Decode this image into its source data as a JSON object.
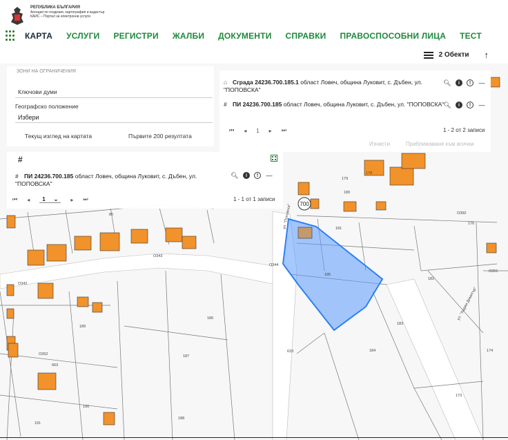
{
  "header": {
    "logo": {
      "line1": "РЕПУБЛИКА БЪЛГАРИЯ",
      "line2": "Агенция по геодезия, картография и кадастър",
      "line3": "КАИС – Портал за електронни услуги"
    },
    "nav": [
      {
        "label": "КАРТА",
        "active": true
      },
      {
        "label": "УСЛУГИ"
      },
      {
        "label": "РЕГИСТРИ"
      },
      {
        "label": "ЖАЛБИ"
      },
      {
        "label": "ДОКУМЕНТИ"
      },
      {
        "label": "СПРАВКИ"
      },
      {
        "label": "ПРАВОСПОСОБНИ ЛИЦА"
      },
      {
        "label": "ТЕСТ"
      }
    ],
    "objects_label": "2 Обекти",
    "up_arrow": "↑"
  },
  "search_panel": {
    "section": "ЗОНИ НА ОГРАНИЧЕНИЯ",
    "keywords_label": "Ключови думи",
    "geo_label": "Географско положение",
    "geo_value": "Избери",
    "option_current": "Текущ изглед на картата",
    "option_first": "Първите 200 резултата"
  },
  "results_panel": {
    "rows": [
      {
        "icon": "building-icon",
        "code": "Сграда 24236.700.185.1",
        "address": "област Ловеч, община Луковит, с. Дъбен, ул. \"ПОПОВСКА\""
      },
      {
        "icon": "parcel-icon",
        "code": "ПИ 24236.700.185",
        "address": "област Ловеч, община Луковит, с. Дъбен, ул. \"ПОПОВСКА\""
      }
    ],
    "page": "1",
    "count": "1 - 2 от 2 записи",
    "clear_label": "Изчисти",
    "apply_label": "Приближаване към всички"
  },
  "selected_panel": {
    "code": "ПИ 24236.700.185",
    "address": "област Ловеч, община Луковит, с. Дъбен, ул. \"ПОПОВСКА\"",
    "page": "1",
    "count": "1 - 1 от 1 записи"
  },
  "map": {
    "highlight_color": "#5b9bff",
    "building_color": "#f2922a",
    "labels": {
      "street_700": "700",
      "street_popovska": "ул. \"Поповска\"",
      "street_hadzhi": "ул. \"Хаджи Димитър\"",
      "p185": "185",
      "p181": "181",
      "p182": "182",
      "p183": "183",
      "p184": "184",
      "p186": "186",
      "p187": "187",
      "p188": "188",
      "p189": "189",
      "p176": "176",
      "p178": "178",
      "p179": "179",
      "p180": "180",
      "p174": "174",
      "p173": "173",
      "p190": "190",
      "p191": "191",
      "p80": "80",
      "p633": "633",
      "p663": "663",
      "o343": "О343",
      "o344": "О344",
      "o342": "О342",
      "o350": "О350",
      "o351": "О351",
      "o352": "О352"
    }
  }
}
